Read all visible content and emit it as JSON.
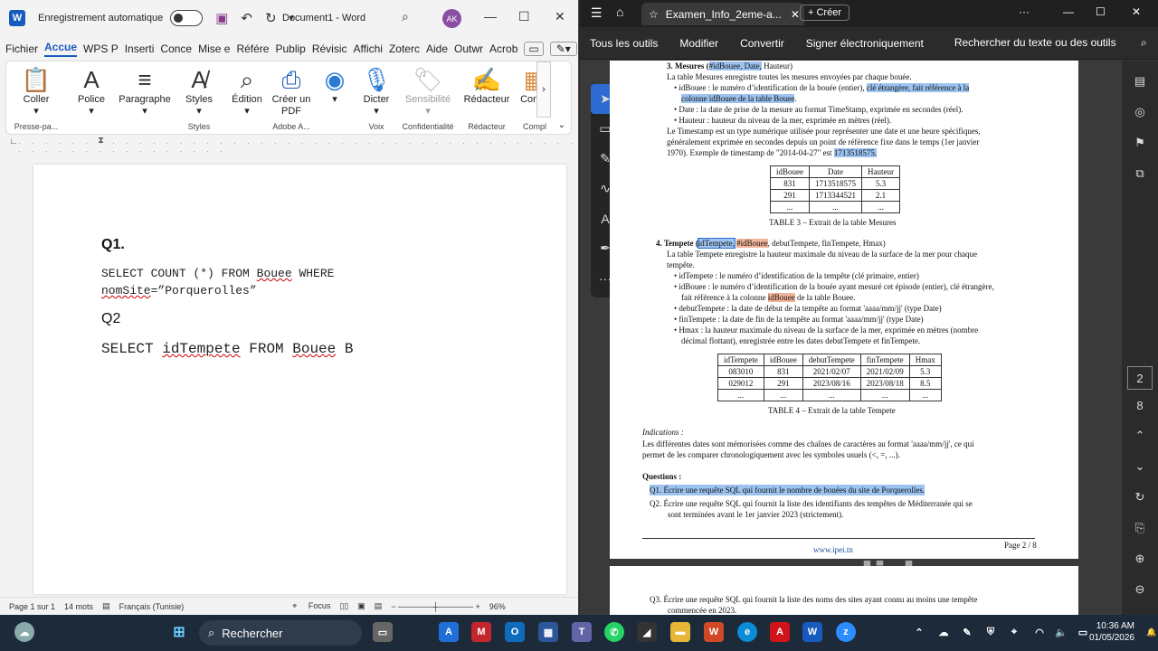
{
  "word": {
    "autosave_label": "Enregistrement automatique",
    "doc_title": "Document1 - Word",
    "avatar": "AK",
    "tabs": [
      "Fichier",
      "Accue",
      "WPS P",
      "Inserti",
      "Conce",
      "Mise e",
      "Référe",
      "Publip",
      "Révisic",
      "Affichi",
      "Zoterc",
      "Aide",
      "Outwr",
      "Acrob"
    ],
    "ribbon": {
      "coller": "Coller",
      "police": "Police",
      "paragraphe": "Paragraphe",
      "styles": "Styles",
      "edition": "Édition",
      "creer_pdf": "Créer un PDF",
      "dicter": "Dicter",
      "sensibilite": "Sensibilité",
      "redacteur": "Rédacteur",
      "compl": "Compl",
      "g_presse": "Presse-pa...",
      "g_styles": "Styles",
      "g_adobe": "Adobe A...",
      "g_voix": "Voix",
      "g_conf": "Confidentialité",
      "g_red": "Rédacteur",
      "g_compl": "Compl"
    },
    "doc": {
      "q1": "Q1.",
      "sql1_line1_a": "SELECT COUNT (*) FROM ",
      "sql1_line1_b": "Bouee",
      "sql1_line1_c": " WHERE",
      "sql1_line2_a": "nomSite",
      "sql1_line2_b": "=”Porquerolles”",
      "q2": "Q2",
      "sql2_a": "SELECT ",
      "sql2_b": "idTempete",
      "sql2_c": " FROM ",
      "sql2_d": "Bouee",
      "sql2_e": " B"
    },
    "status": {
      "page": "Page 1 sur 1",
      "words": "14 mots",
      "lang": "Français (Tunisie)",
      "focus": "Focus",
      "zoom": "96%"
    }
  },
  "pdf": {
    "tab_title": "Examen_Info_2eme-a...",
    "new_button": "Créer",
    "tools": [
      "Tous les outils",
      "Modifier",
      "Convertir",
      "Signer électroniquement",
      "Rechercher du texte ou des outils"
    ],
    "page_num": "2",
    "page_total": "8",
    "content": {
      "s3_title": "3.  Mesures (",
      "s3_keys": "#idBouee, Date,",
      "s3_end": " Hauteur)",
      "s3_desc": "La table Mesures enregistre toutes les mesures envoyées par chaque bouée.",
      "s3_b1a": "• idBouee : le numéro d’identification de la bouée (entier), ",
      "s3_b1b": "clé étrangère, fait référence à la",
      "s3_b1c": "colonne ",
      "s3_b1d": "idBouee de la table Bouee",
      "s3_b1e": ".",
      "s3_b2": "• Date : la date de prise de la mesure au format TimeStamp, exprimée en secondes (réel).",
      "s3_b3": "• Hauteur : hauteur du niveau de la mer, exprimée en mètres (réel).",
      "s3_ts1": "Le Timestamp est un type numérique utilisée pour représenter une date et une heure spécifiques,",
      "s3_ts2": "généralement exprimée en secondes depuis un point de référence fixe dans le temps (1er janvier",
      "s3_ts3a": "1970). Exemple de timestamp de \"2014-04-27\" est ",
      "s3_ts3b": "1713518575.",
      "t3_head": [
        "idBouee",
        "Date",
        "Hauteur"
      ],
      "t3_rows": [
        [
          "831",
          "1713518575",
          "5.3"
        ],
        [
          "291",
          "1713344521",
          "2.1"
        ],
        [
          "...",
          "...",
          "..."
        ]
      ],
      "t3_caption": "TABLE 3 – Extrait de la table Mesures",
      "s4_title": "4.  Tempete (",
      "s4_key1": "idTempete,",
      "s4_key2": "#idBouee",
      "s4_end": ", debutTempete, finTempete, Hmax)",
      "s4_desc1": "La table Tempete enregistre la hauteur maximale du niveau de la surface de la mer pour chaque",
      "s4_desc2": "tempête.",
      "s4_b1": "• idTempete : le numéro d’identification de la tempête (clé primaire, entier)",
      "s4_b2a": "• idBouee : le numéro d’identification de la bouée ayant mesuré cet épisode (entier), clé étrangère,",
      "s4_b2b": "fait référence à la colonne ",
      "s4_b2c": "idBouee",
      "s4_b2d": " de la table Bouee.",
      "s4_b3": "• debutTempete : la date de début de la tempête au format 'aaaa/mm/jj' (type Date)",
      "s4_b4": "• finTempete : la date de fin de la tempête au format 'aaaa/mm/jj' (type Date)",
      "s4_b5a": "• Hmax : la hauteur maximale du niveau de la surface de la mer, exprimée en mètres (nombre",
      "s4_b5b": "décimal flottant), enregistrée entre les dates debutTempete et finTempete.",
      "t4_head": [
        "idTempete",
        "idBouee",
        "debutTempete",
        "finTempete",
        "Hmax"
      ],
      "t4_rows": [
        [
          "083010",
          "831",
          "2021/02/07",
          "2021/02/09",
          "5.3"
        ],
        [
          "029012",
          "291",
          "2023/08/16",
          "2023/08/18",
          "8.5"
        ],
        [
          "...",
          "...",
          "...",
          "...",
          "..."
        ]
      ],
      "t4_caption": "TABLE 4 – Extrait de la table Tempete",
      "ind_title": "Indications :",
      "ind_1": "Les différentes dates sont mémorisées comme des chaînes de caractères au format 'aaaa/mm/jj', ce qui",
      "ind_2": "permet de les comparer chronologiquement avec les symboles usuels (<, =, ...).",
      "questions": "Questions :",
      "q1": "Q1.  Écrire une requête SQL qui fournit le nombre de bouées du site de Porquerolles.",
      "q2a": "Q2.  Écrire une requête SQL qui fournit la liste des identifiants des tempêtes de Méditerranée qui se",
      "q2b": "sont terminées avant le 1er janvier 2023 (strictement).",
      "footer_site": "www.ipei.tn",
      "footer_page": "Page 2 / 8",
      "q3a": "Q3.  Écrire une requête SQL qui fournit la liste des noms des sites ayant connu au moins une tempête",
      "q3b": "commencée en 2023."
    }
  },
  "taskbar": {
    "search": "Rechercher",
    "time": "10:36 AM",
    "date": "01/05/2026",
    "watermark": "clideo.com"
  }
}
